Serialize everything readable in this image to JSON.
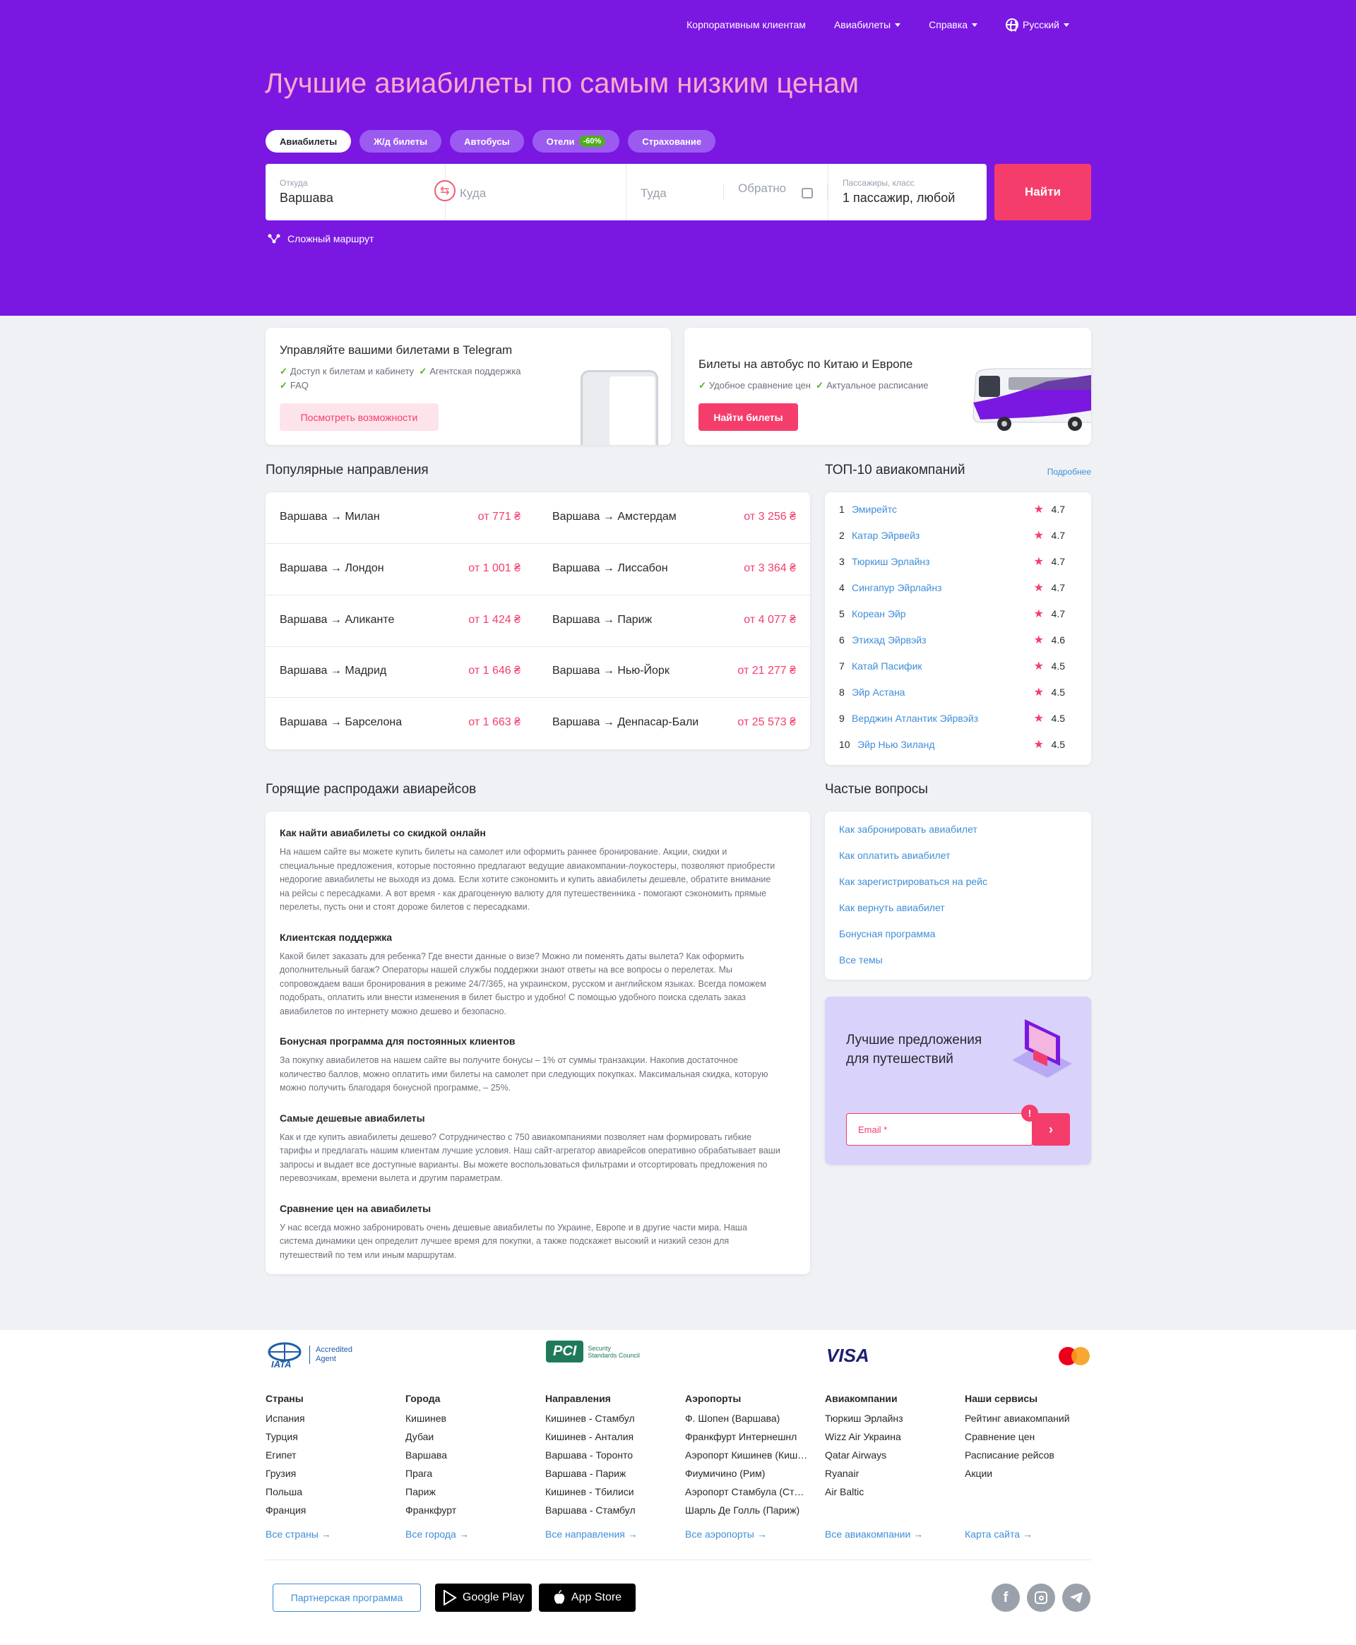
{
  "nav": {
    "corporate": "Корпоративным клиентам",
    "flights": "Авиабилеты",
    "help": "Справка",
    "language": "Русский"
  },
  "hero": {
    "headline": "Лучшие авиабилеты по самым низким ценам",
    "tabs": [
      {
        "label": "Авиабилеты",
        "active": true
      },
      {
        "label": "Ж/д билеты"
      },
      {
        "label": "Автобусы"
      },
      {
        "label": "Отели",
        "badge": "-60%"
      },
      {
        "label": "Страхование"
      }
    ],
    "search": {
      "from_label": "Откуда",
      "from_value": "Варшава",
      "to_placeholder": "Куда",
      "depart_placeholder": "Туда",
      "return_placeholder": "Обратно",
      "pax_label": "Пассажиры, класс",
      "pax_value": "1 пассажир, любой",
      "find_button": "Найти"
    },
    "complex_route": "Сложный маршрут"
  },
  "promo": {
    "telegram": {
      "title": "Управляйте вашими билетами в Telegram",
      "features": [
        "Доступ к билетам и кабинету",
        "Агентская поддержка",
        "FAQ"
      ],
      "button": "Посмотреть возможности"
    },
    "bus": {
      "title": "Билеты на автобус по Китаю и Европе",
      "features": [
        "Удобное сравнение цен",
        "Актуальное расписание"
      ],
      "button": "Найти билеты"
    }
  },
  "popular": {
    "title": "Популярные направления",
    "routes": [
      {
        "route": "Варшава → Милан",
        "price": "от 771 ₴"
      },
      {
        "route": "Варшава → Амстердам",
        "price": "от 3 256 ₴"
      },
      {
        "route": "Варшава → Лондон",
        "price": "от 1 001 ₴"
      },
      {
        "route": "Варшава → Лиссабон",
        "price": "от 3 364 ₴"
      },
      {
        "route": "Варшава → Аликанте",
        "price": "от 1 424 ₴"
      },
      {
        "route": "Варшава → Париж",
        "price": "от 4 077 ₴"
      },
      {
        "route": "Варшава → Мадрид",
        "price": "от 1 646 ₴"
      },
      {
        "route": "Варшава → Нью-Йорк",
        "price": "от 21 277 ₴"
      },
      {
        "route": "Варшава → Барселона",
        "price": "от 1 663 ₴"
      },
      {
        "route": "Варшава → Денпасар-Бали",
        "price": "от 25 573 ₴"
      }
    ]
  },
  "top10": {
    "title": "ТОП-10 авиакомпаний",
    "more": "Подробнее",
    "airlines": [
      {
        "num": "1",
        "name": "Эмирейтс",
        "rating": "4.7"
      },
      {
        "num": "2",
        "name": "Катар Эйрвейз",
        "rating": "4.7"
      },
      {
        "num": "3",
        "name": "Тюркиш Эрлайнз",
        "rating": "4.7"
      },
      {
        "num": "4",
        "name": "Сингапур Эйрлайнз",
        "rating": "4.7"
      },
      {
        "num": "5",
        "name": "Кореан Эйр",
        "rating": "4.7"
      },
      {
        "num": "6",
        "name": "Этихад Эйрвэйз",
        "rating": "4.6"
      },
      {
        "num": "7",
        "name": "Катай Пасифик",
        "rating": "4.5"
      },
      {
        "num": "8",
        "name": "Эйр Астана",
        "rating": "4.5"
      },
      {
        "num": "9",
        "name": "Верджин Атлантик Эйрвэйз",
        "rating": "4.5"
      },
      {
        "num": "10",
        "name": "Эйр Нью Зиланд",
        "rating": "4.5"
      }
    ]
  },
  "sales": {
    "title": "Горящие распродажи авиарейсов",
    "articles": [
      {
        "h": "Как найти авиабилеты со скидкой онлайн",
        "p": "На нашем сайте вы можете купить билеты на самолет или оформить раннее бронирование. Акции, скидки и специальные предложения, которые постоянно предлагают ведущие авиакомпании-лоукостеры, позволяют приобрести недорогие авиабилеты не выходя из дома. Если хотите сэкономить и купить авиабилеты дешевле, обратите внимание на рейсы с пересадками. А вот время - как драгоценную валюту для путешественника - помогают сэкономить прямые перелеты, пусть они и стоят дороже билетов с пересадками."
      },
      {
        "h": "Клиентская поддержка",
        "p": "Какой билет заказать для ребенка? Где внести данные о визе? Можно ли поменять даты вылета? Как оформить дополнительный багаж? Операторы нашей службы поддержки знают ответы на все вопросы о перелетах. Мы сопровождаем ваши бронирования в режиме 24/7/365, на украинском, русском и английском языках. Всегда поможем подобрать, оплатить или внести изменения в билет быстро и удобно! С помощью удобного поиска сделать заказ авиабилетов по интернету можно дешево и безопасно."
      },
      {
        "h": "Бонусная программа для постоянных клиентов",
        "p": "За покупку авиабилетов на нашем сайте вы получите бонусы – 1% от суммы транзакции. Накопив достаточное количество баллов, можно оплатить ими билеты на самолет при следующих покупках. Максимальная скидка, которую можно получить благодаря бонусной программе, – 25%."
      },
      {
        "h": "Самые дешевые авиабилеты",
        "p": "Как и где купить авиабилеты дешево? Сотрудничество с 750 авиакомпаниями позволяет нам формировать гибкие тарифы и предлагать нашим клиентам лучшие условия. Наш сайт-агрегатор авиарейсов оперативно обрабатывает ваши запросы и выдает все доступные варианты. Вы можете воспользоваться фильтрами и отсортировать предложения по перевозчикам, времени вылета и другим параметрам."
      },
      {
        "h": "Сравнение цен на авиабилеты",
        "p": "У нас всегда можно забронировать очень дешевые авиабилеты по Украине, Европе и в другие части мира. Наша система динамики цен определит лучшее время для покупки, а также подскажет высокий и низкий сезон для путешествий по тем или иным маршрутам."
      }
    ]
  },
  "faq": {
    "title": "Частые вопросы",
    "items": [
      "Как забронировать авиабилет",
      "Как оплатить авиабилет",
      "Как зарегистрироваться на рейс",
      "Как вернуть авиабилет",
      "Бонусная программа",
      "Все темы"
    ]
  },
  "subscribe": {
    "title_line1": "Лучшие предложения",
    "title_line2": "для путешествий",
    "email_placeholder": "Email *",
    "error_mark": "!"
  },
  "footer": {
    "logos": {
      "iata_line1": "Accredited",
      "iata_line2": "Agent",
      "iata": "IATA",
      "pci": "PCI",
      "pci_line1": "Security",
      "pci_line2": "Standards Council",
      "visa": "VISA"
    },
    "columns": [
      {
        "title": "Страны",
        "links": [
          "Испания",
          "Турция",
          "Египет",
          "Грузия",
          "Польша",
          "Франция"
        ],
        "more": "Все страны →"
      },
      {
        "title": "Города",
        "links": [
          "Кишинев",
          "Дубаи",
          "Варшава",
          "Прага",
          "Париж",
          "Франкфурт"
        ],
        "more": "Все города →"
      },
      {
        "title": "Направления",
        "links": [
          "Кишинев - Стамбул",
          "Кишинев - Анталия",
          "Варшава - Торонто",
          "Варшава - Париж",
          "Кишинев - Тбилиси",
          "Варшава - Стамбул"
        ],
        "more": "Все направления →"
      },
      {
        "title": "Аэропорты",
        "links": [
          "Ф. Шопен (Варшава)",
          "Франкфурт Интернешнл",
          "Аэропорт Кишинев (Кишинев)",
          "Фиумичино (Рим)",
          "Аэропорт Стамбула (Стамбул)",
          "Шарль Де Голль (Париж)"
        ],
        "more": "Все аэропорты →"
      },
      {
        "title": "Авиакомпании",
        "links": [
          "Тюркиш Эрлайнз",
          "Wizz Air Украина",
          "Qatar Airways",
          "Ryanair",
          "Air Baltic"
        ],
        "more": "Все авиакомпании →"
      },
      {
        "title": "Наши сервисы",
        "links": [
          "Рейтинг авиакомпаний",
          "Сравнение цен",
          "Расписание рейсов",
          "Акции"
        ],
        "more": "Карта сайта →"
      }
    ],
    "partner": "Партнерская программа",
    "google_play": "Google Play",
    "app_store": "App Store"
  }
}
